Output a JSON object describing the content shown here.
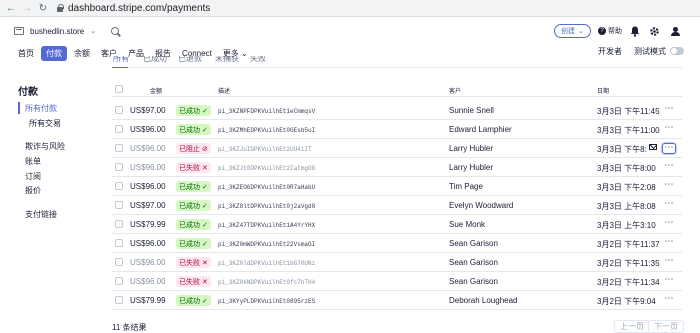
{
  "browser": {
    "back_icon": "arrow-left-icon",
    "forward_icon": "arrow-right-icon",
    "reload_icon": "reload-icon",
    "url": "dashboard.stripe.com/payments"
  },
  "header": {
    "account_name": "bushedlin.store",
    "search_placeholder": "",
    "create_label": "创建",
    "help_label": "帮助"
  },
  "nav": {
    "items": [
      "首页",
      "付款",
      "余额",
      "客户",
      "产品",
      "报告",
      "Connect",
      "更多"
    ],
    "more_icon": "chevron-down-icon",
    "developers_label": "开发者",
    "test_mode_label": "测试模式"
  },
  "sidebar": {
    "title": "付款",
    "all_payments": "所有付款",
    "all_transactions": "所有交易",
    "fraud_risk": "欺诈与风险",
    "bills": "账单",
    "subscriptions": "订阅",
    "quotes": "报价",
    "payment_links": "支付链接"
  },
  "subtabs": [
    "所有",
    "已成功",
    "已退款",
    "未捕获",
    "失败"
  ],
  "table": {
    "headers": {
      "amount": "金额",
      "description": "描述",
      "customer": "客户",
      "date": "日期"
    },
    "rows": [
      {
        "amount": "US$97.00",
        "status": "已成功",
        "status_type": "succeeded",
        "description": "pi_3KZNPFDPKVuilhEt1eCmmqsV",
        "customer": "Sunnie Snell",
        "date": "3月3日 下午11:45"
      },
      {
        "amount": "US$96.00",
        "status": "已成功",
        "status_type": "succeeded",
        "description": "pi_3KZMhEDPKVuilhEt0GEsb5uI",
        "customer": "Edward Lamphier",
        "date": "3月3日 下午11:00"
      },
      {
        "amount": "US$96.00",
        "status": "已阻止",
        "status_type": "blocked",
        "description": "pi_3KZJuIDPKVuilhEt2UU4iIT",
        "customer": "Larry Hubler",
        "date": "3月3日 下午8:"
      },
      {
        "amount": "US$96.00",
        "status": "已失败",
        "status_type": "failed",
        "description": "pi_3KZJt0DPKVuilhEt2IatmgOG",
        "customer": "Larry Hubler",
        "date": "3月3日 下午8:00"
      },
      {
        "amount": "US$96.00",
        "status": "已成功",
        "status_type": "succeeded",
        "description": "pi_3KZEO6DPKVuilhEt0R7aHabU",
        "customer": "Tim Page",
        "date": "3月3日 下午2:08"
      },
      {
        "amount": "US$97.00",
        "status": "已成功",
        "status_type": "succeeded",
        "description": "pi_3KZ8ltDPKVuilhEt0j2aVgd8",
        "customer": "Evelyn Woodward",
        "date": "3月3日 上午8:08"
      },
      {
        "amount": "US$79.99",
        "status": "已成功",
        "status_type": "succeeded",
        "description": "pi_3KZ47TDPKVuilhEt1A4YrYHX",
        "customer": "Sue Monk",
        "date": "3月3日 上午3:10"
      },
      {
        "amount": "US$96.00",
        "status": "已成功",
        "status_type": "succeeded",
        "description": "pi_3KZ0mWDPKVuilhEt22VsmaGI",
        "customer": "Sean Garison",
        "date": "3月2日 下午11:37"
      },
      {
        "amount": "US$96.00",
        "status": "已失败",
        "status_type": "failed",
        "description": "pi_3KZ0ldDPKVuilhEt1bG70UNz",
        "customer": "Sean Garison",
        "date": "3月2日 下午11:35"
      },
      {
        "amount": "US$96.00",
        "status": "已失败",
        "status_type": "failed",
        "description": "pi_3KZ0kNDPKVuilhEt0fc7hTH4",
        "customer": "Sean Garison",
        "date": "3月2日 下午11:34"
      },
      {
        "amount": "US$79.99",
        "status": "已成功",
        "status_type": "succeeded",
        "description": "pi_3KYyPLDPKVuilhEt0895rzES",
        "customer": "Deborah Loughead",
        "date": "3月2日 下午9:04"
      }
    ]
  },
  "footer": {
    "result_count": "11 条结果",
    "prev_label": "上一页",
    "next_label": "下一页"
  },
  "colors": {
    "accent": "#5469d4",
    "success_bg": "#d7f7c2",
    "success_text": "#05690d",
    "failed_bg": "#ffe7f2",
    "failed_text": "#b3093c"
  }
}
